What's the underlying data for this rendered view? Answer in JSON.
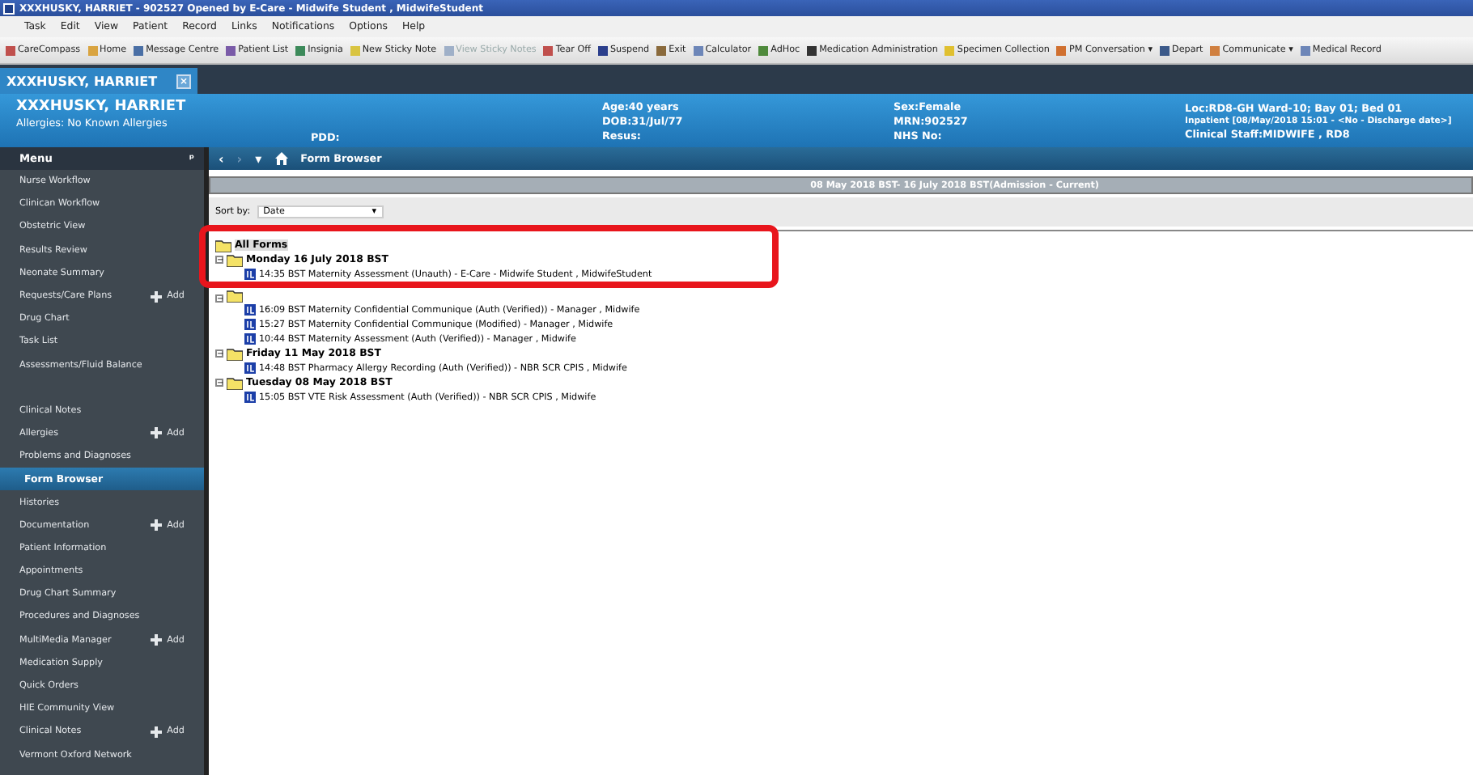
{
  "window": {
    "title": "XXXHUSKY, HARRIET - 902527 Opened by E-Care - Midwife Student , MidwifeStudent"
  },
  "menu_bar": [
    "Task",
    "Edit",
    "View",
    "Patient",
    "Record",
    "Links",
    "Notifications",
    "Options",
    "Help"
  ],
  "toolbar": [
    {
      "label": "CareCompass",
      "color": "#c0504d",
      "disabled": false
    },
    {
      "label": "Home",
      "color": "#d9a441",
      "disabled": false
    },
    {
      "label": "Message Centre",
      "color": "#4a6fa5",
      "disabled": false
    },
    {
      "label": "Patient List",
      "color": "#7a5ba8",
      "disabled": false
    },
    {
      "label": "Insignia",
      "color": "#3c8a5a",
      "disabled": false
    },
    {
      "label": "New Sticky Note",
      "color": "#d9c441",
      "disabled": false
    },
    {
      "label": "View Sticky Notes",
      "color": "#9fb0c8",
      "disabled": true
    },
    {
      "label": "Tear Off",
      "color": "#c0504d",
      "disabled": false
    },
    {
      "label": "Suspend",
      "color": "#2b3f8c",
      "disabled": false
    },
    {
      "label": "Exit",
      "color": "#8a6a3c",
      "disabled": false
    },
    {
      "label": "Calculator",
      "color": "#6d86b8",
      "disabled": false
    },
    {
      "label": "AdHoc",
      "color": "#4f8a3c",
      "disabled": false
    },
    {
      "label": "Medication Administration",
      "color": "#333333",
      "disabled": false
    },
    {
      "label": "Specimen Collection",
      "color": "#e0c030",
      "disabled": false
    },
    {
      "label": "PM Conversation",
      "color": "#d07030",
      "disabled": false,
      "dropdown": "▾"
    },
    {
      "label": "Depart",
      "color": "#3c5a8a",
      "disabled": false
    },
    {
      "label": "Communicate",
      "color": "#d08040",
      "disabled": false,
      "dropdown": "▾"
    },
    {
      "label": "Medical Record",
      "color": "#6d86b8",
      "disabled": false
    }
  ],
  "patient_tab": {
    "label": "XXXHUSKY, HARRIET",
    "close": "×"
  },
  "banner": {
    "name": "XXXHUSKY, HARRIET",
    "allergies": "Allergies: No Known Allergies",
    "pdd": "PDD:",
    "col_1": [
      "Age:40 years",
      "DOB:31/Jul/77",
      "Resus:"
    ],
    "col_2": [
      "Sex:Female",
      "MRN:902527",
      "NHS No:"
    ],
    "col_3": [
      "Loc:RD8-GH Ward-10; Bay 01; Bed 01",
      "Inpatient [08/May/2018 15:01 - <No - Discharge date>]",
      "Clinical Staff:MIDWIFE , RD8"
    ]
  },
  "sidebar": {
    "title": "Menu",
    "pin": "ᵖ",
    "items": [
      {
        "label": "Nurse Workflow",
        "selected": false
      },
      {
        "label": "Clinican Workflow",
        "selected": false
      },
      {
        "label": "Obstetric View",
        "selected": false
      },
      {
        "label": "Results Review",
        "selected": false
      },
      {
        "label": "Neonate Summary",
        "selected": false
      },
      {
        "label": "Requests/Care Plans",
        "selected": false,
        "add": "Add"
      },
      {
        "label": "Drug Chart",
        "selected": false
      },
      {
        "label": "Task List",
        "selected": false
      },
      {
        "label": "Assessments/Fluid Balance",
        "selected": false
      },
      {
        "label": "Clinical Notes",
        "selected": false,
        "gap_before": true
      },
      {
        "label": "Allergies",
        "selected": false,
        "add": "Add"
      },
      {
        "label": "Problems and Diagnoses",
        "selected": false
      },
      {
        "label": "Form Browser",
        "selected": true
      },
      {
        "label": "Histories",
        "selected": false
      },
      {
        "label": "Documentation",
        "selected": false,
        "add": "Add"
      },
      {
        "label": "Patient Information",
        "selected": false
      },
      {
        "label": "Appointments",
        "selected": false
      },
      {
        "label": "Drug Chart Summary",
        "selected": false
      },
      {
        "label": "Procedures and Diagnoses",
        "selected": false
      },
      {
        "label": "MultiMedia Manager",
        "selected": false,
        "add": "Add"
      },
      {
        "label": "Medication Supply",
        "selected": false
      },
      {
        "label": "Quick Orders",
        "selected": false
      },
      {
        "label": "HIE Community View",
        "selected": false
      },
      {
        "label": "Clinical Notes",
        "selected": false,
        "add": "Add"
      },
      {
        "label": "Vermont Oxford Network",
        "selected": false
      }
    ]
  },
  "nav": {
    "back": "‹",
    "forward": "›",
    "history": "▾",
    "title": "Form Browser"
  },
  "date_range": "08 May 2018 BST- 16 July 2018 BST(Admission - Current)",
  "sort": {
    "label": "Sort by:",
    "value": "Date",
    "caret": "▾"
  },
  "tree": {
    "root": "All Forms",
    "collapse_glyph": "−",
    "groups": [
      {
        "label": "Monday 16 July 2018 BST",
        "expanded": true,
        "forms": [
          "14:35 BST Maternity Assessment (Unauth) - E-Care - Midwife Student , MidwifeStudent"
        ]
      },
      {
        "expanded": true,
        "forms": [
          "16:09 BST Maternity Confidential Communique (Auth (Verified)) - Manager , Midwife",
          "15:27 BST Maternity Confidential Communique (Modified) - Manager , Midwife",
          "10:44 BST Maternity Assessment (Auth (Verified)) - Manager , Midwife"
        ]
      },
      {
        "label": "Friday 11 May 2018 BST",
        "expanded": true,
        "forms": [
          "14:48 BST Pharmacy Allergy Recording (Auth (Verified)) - NBR SCR CPIS , Midwife"
        ]
      },
      {
        "label": "Tuesday 08 May 2018 BST",
        "expanded": true,
        "forms": [
          "15:05 BST VTE Risk Assessment (Auth (Verified)) - NBR SCR CPIS , Midwife"
        ]
      }
    ]
  }
}
